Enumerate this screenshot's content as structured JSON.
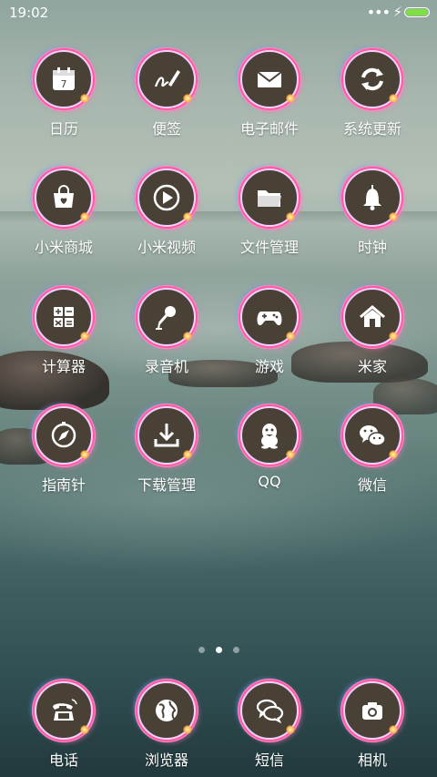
{
  "status": {
    "time": "19:02",
    "dots": "•••",
    "battery_color": "#7ee141"
  },
  "apps": {
    "calendar": "日历",
    "notes": "便签",
    "email": "电子邮件",
    "update": "系统更新",
    "store": "小米商城",
    "video": "小米视频",
    "files": "文件管理",
    "clock": "时钟",
    "calculator": "计算器",
    "recorder": "录音机",
    "games": "游戏",
    "mihome": "米家",
    "compass": "指南针",
    "downloads": "下载管理",
    "qq": "QQ",
    "wechat": "微信"
  },
  "calendar_day": "7",
  "dock": {
    "phone": "电话",
    "browser": "浏览器",
    "sms": "短信",
    "camera": "相机"
  },
  "pager": {
    "count": 3,
    "active": 1
  },
  "colors": {
    "icon_bg": "#4a4136",
    "ring": "#ff5aa0"
  }
}
